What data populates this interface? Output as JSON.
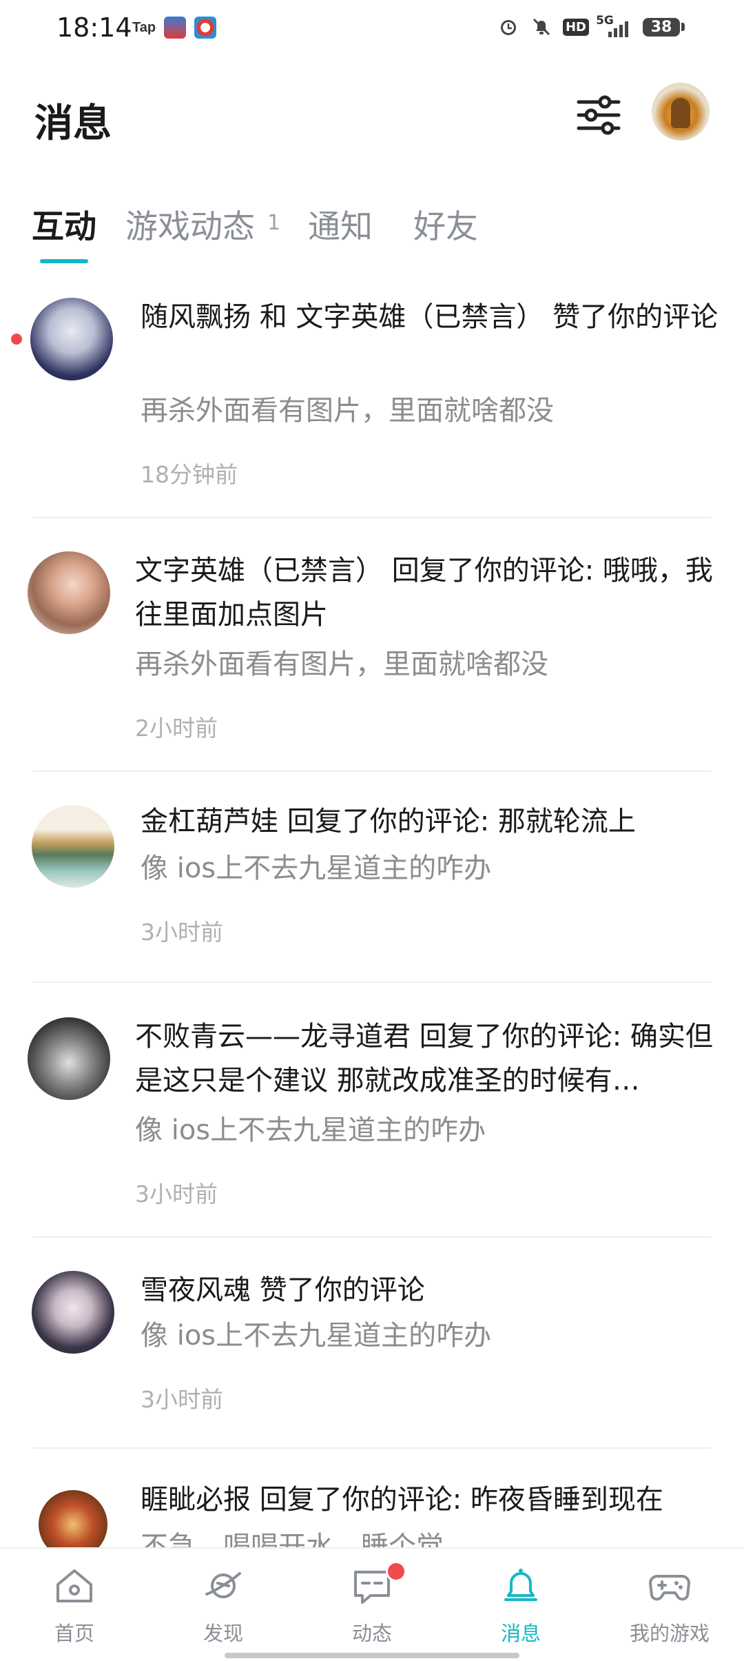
{
  "status_bar": {
    "time": "18:14",
    "app_tap": "Tap",
    "hd": "HD",
    "network": "5G",
    "battery": "38"
  },
  "header": {
    "title": "消息"
  },
  "tabs": [
    {
      "label": "互动",
      "active": true
    },
    {
      "label": "游戏动态",
      "badge": "1"
    },
    {
      "label": "通知"
    },
    {
      "label": "好友"
    }
  ],
  "messages": [
    {
      "title": "随风飘扬 和 文字英雄（已禁言） 赞了你的评论",
      "quote": "再杀外面看有图片，里面就啥都没",
      "time": "18分钟前",
      "unread": true
    },
    {
      "title": "文字英雄（已禁言） 回复了你的评论: 哦哦，我往里面加点图片",
      "quote": "再杀外面看有图片，里面就啥都没",
      "time": "2小时前"
    },
    {
      "title": "金杠葫芦娃 回复了你的评论: 那就轮流上",
      "quote": "像 ios上不去九星道主的咋办",
      "time": "3小时前"
    },
    {
      "title": "不败青云——龙寻道君 回复了你的评论: 确实但是这只是个建议 那就改成准圣的时候有…",
      "quote": "像 ios上不去九星道主的咋办",
      "time": "3小时前"
    },
    {
      "title": "雪夜风魂 赞了你的评论",
      "quote": "像 ios上不去九星道主的咋办",
      "time": "3小时前"
    },
    {
      "title": "睚眦必报 回复了你的评论: 昨夜昏睡到现在",
      "quote": "不急，喝喝开水，睡个觉"
    }
  ],
  "bottom_nav": [
    {
      "label": "首页",
      "icon": "home-icon"
    },
    {
      "label": "发现",
      "icon": "planet-icon"
    },
    {
      "label": "动态",
      "icon": "chat-icon"
    },
    {
      "label": "消息",
      "icon": "bell-icon",
      "active": true
    },
    {
      "label": "我的游戏",
      "icon": "gamepad-icon"
    }
  ],
  "colors": {
    "accent": "#14b8c4",
    "unread": "#f04a4a",
    "text": "#1a1a1a",
    "muted": "#8c8c8c"
  }
}
